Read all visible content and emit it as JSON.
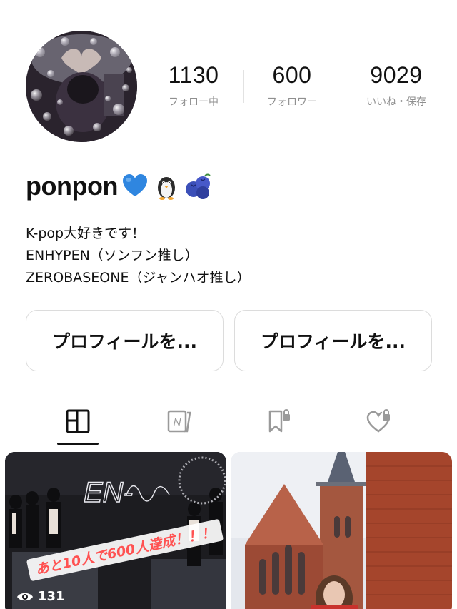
{
  "profile": {
    "name": "ponpon",
    "name_emojis": [
      "blue-heart",
      "penguin",
      "blueberries"
    ],
    "stats": [
      {
        "value": "1130",
        "label": "フォロー中"
      },
      {
        "value": "600",
        "label": "フォロワー"
      },
      {
        "value": "9029",
        "label": "いいね・保存"
      }
    ],
    "bio_lines": [
      "K-pop大好きです！",
      "ENHYPEN（ソンフン推し）",
      "ZEROBASEONE（ジャンハオ推し）"
    ]
  },
  "actions": {
    "edit_profile_label": "プロフィールを...",
    "share_profile_label": "プロフィールを..."
  },
  "tabs": [
    {
      "icon": "grid-icon",
      "active": true
    },
    {
      "icon": "notes-icon",
      "active": false
    },
    {
      "icon": "locked-bookmark-icon",
      "active": false
    },
    {
      "icon": "locked-heart-icon",
      "active": false
    }
  ],
  "posts": [
    {
      "views": "131",
      "banner_text": "あと10人で600人達成！！！",
      "overlay_text": "EN-"
    },
    {
      "views": null
    }
  ],
  "colors": {
    "accent_text": "#111111",
    "muted_text": "#8f8f8f",
    "banner_red": "#ff5252"
  }
}
